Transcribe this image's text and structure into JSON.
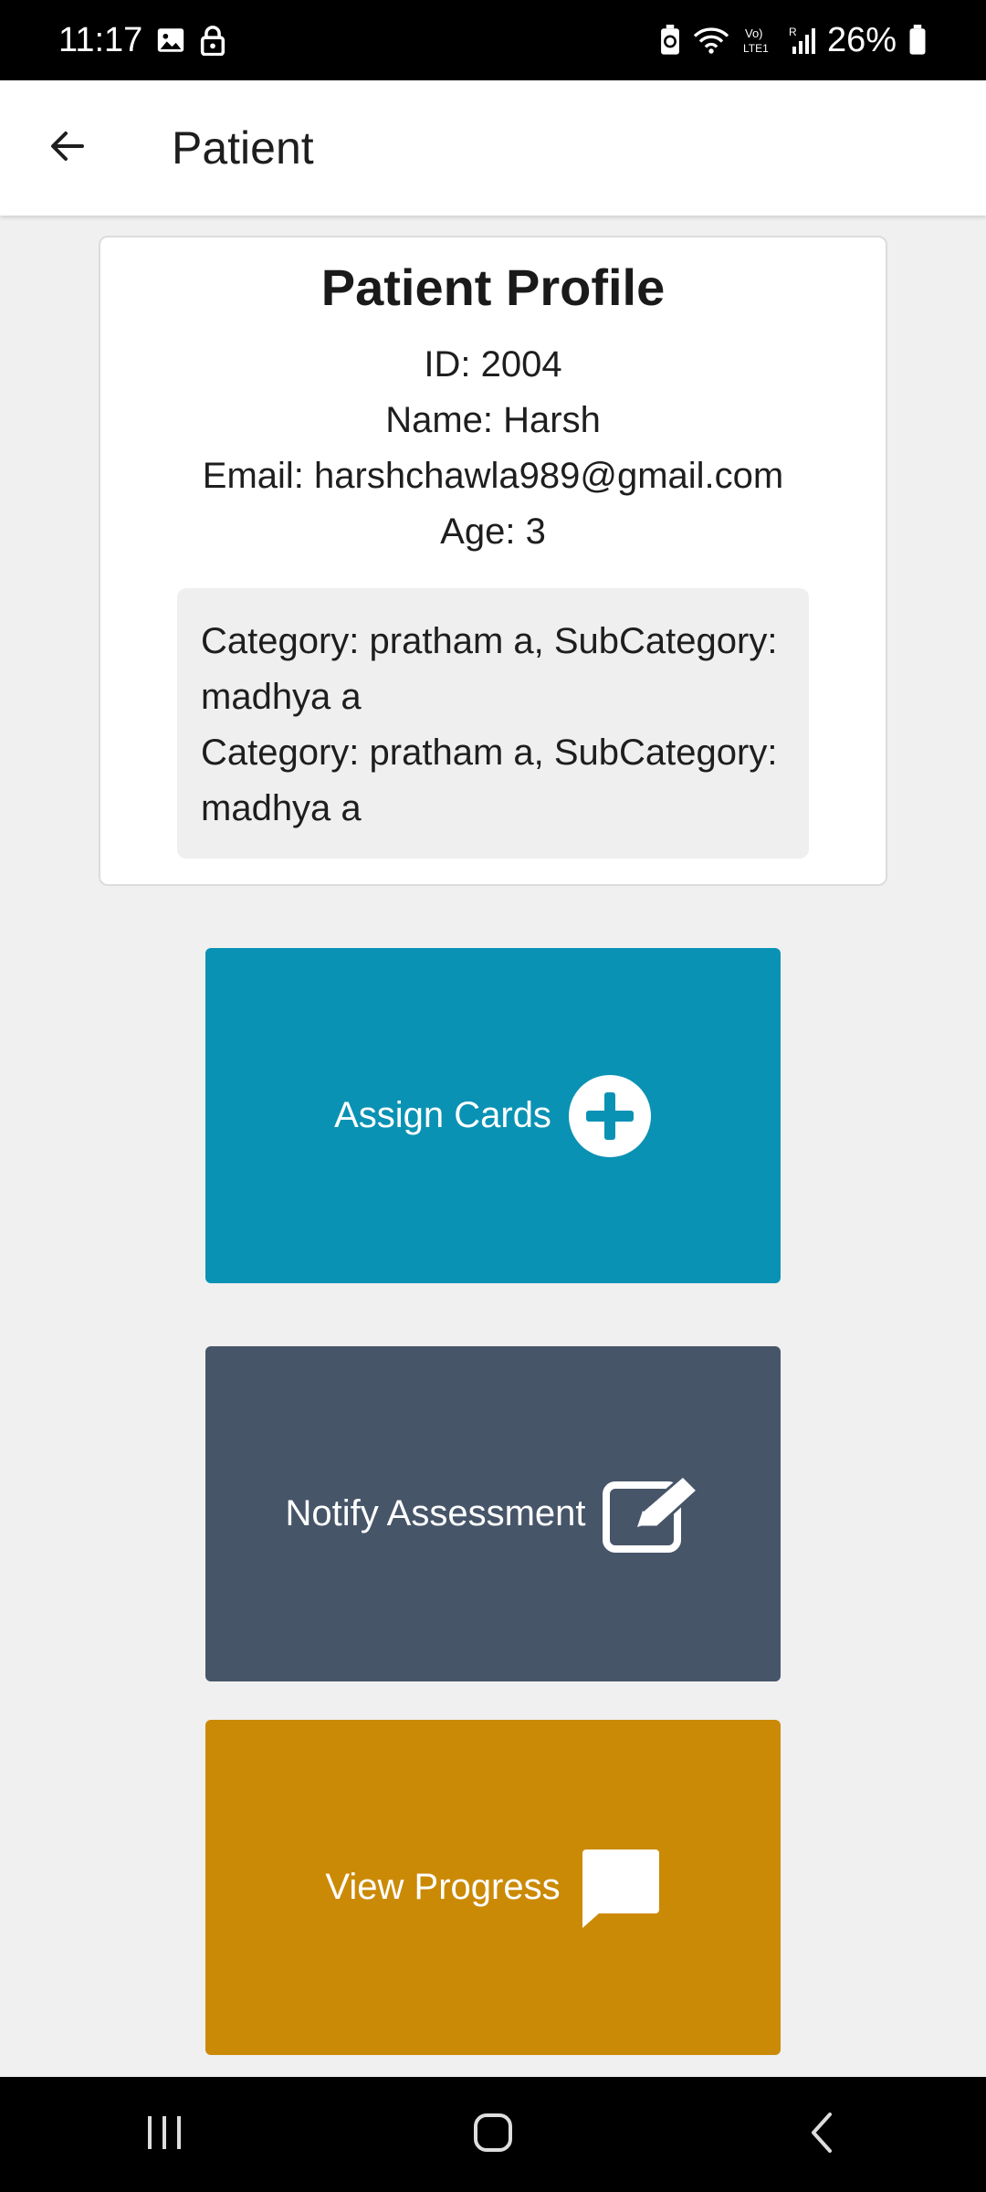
{
  "status_bar": {
    "time": "11:17",
    "battery": "26%",
    "icons": [
      "gallery-icon",
      "lock-icon",
      "battery-saver-icon",
      "wifi-icon",
      "volte-icon",
      "signal-icon",
      "battery-icon"
    ]
  },
  "app_bar": {
    "title": "Patient",
    "back_icon": "arrow-left-icon"
  },
  "profile": {
    "title": "Patient Profile",
    "id": "ID: 2004",
    "name": "Name: Harsh",
    "email": "Email: harshchawla989@gmail.com",
    "age": "Age: 3",
    "categories": [
      "Category: pratham a, SubCategory: madhya a",
      "Category: pratham a, SubCategory: madhya a"
    ]
  },
  "actions": {
    "assign_label": "Assign Cards",
    "assign_icon": "plus-circle-icon",
    "assign_color": "#0992b4",
    "notify_label": "Notify Assessment",
    "notify_icon": "edit-icon",
    "notify_color": "#475569",
    "progress_label": "View Progress",
    "progress_icon": "chat-icon",
    "progress_color": "#cb8a06"
  },
  "nav_bar": {
    "icons": [
      "recent-apps-icon",
      "home-icon",
      "back-icon"
    ]
  }
}
